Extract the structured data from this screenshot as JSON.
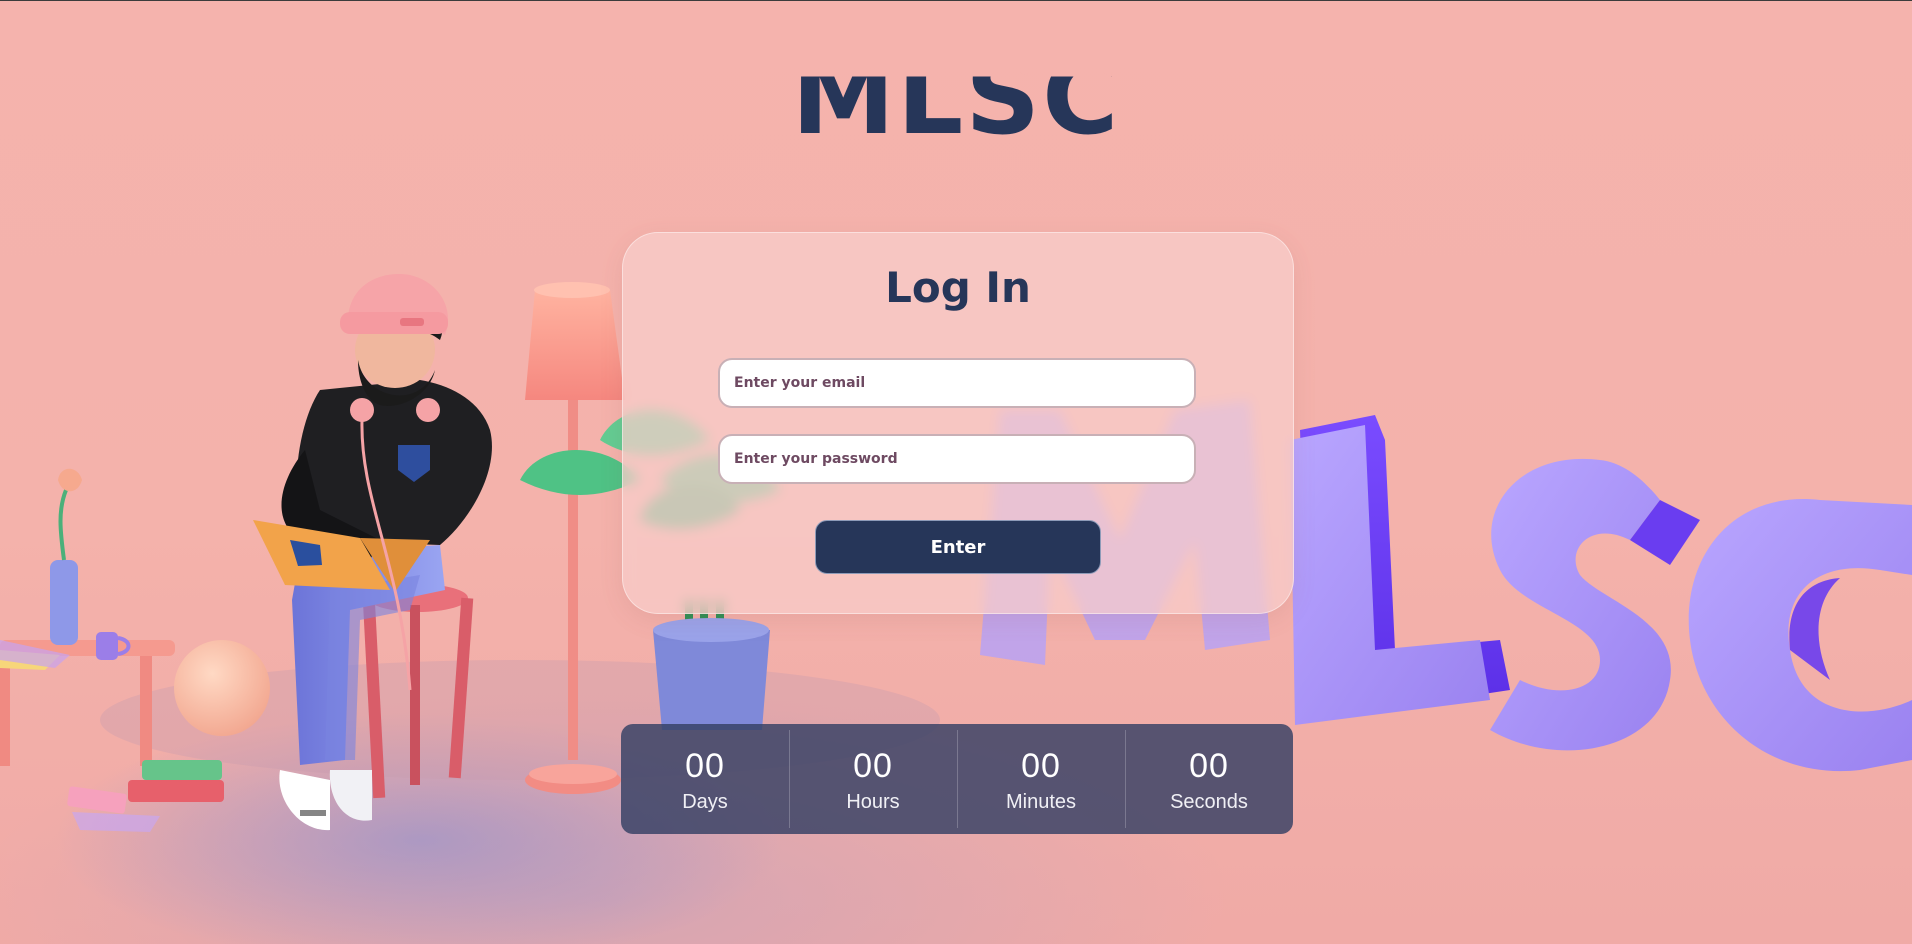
{
  "brand": {
    "logo_text": "MLSC"
  },
  "login": {
    "title": "Log In",
    "email_placeholder": "Enter your email",
    "password_placeholder": "Enter your password",
    "enter_label": "Enter"
  },
  "countdown": [
    {
      "value": "00",
      "label": "Days"
    },
    {
      "value": "00",
      "label": "Hours"
    },
    {
      "value": "00",
      "label": "Minutes"
    },
    {
      "value": "00",
      "label": "Seconds"
    }
  ],
  "illustration": {
    "letters_text": "MLSC",
    "colors": {
      "background": "#f5b3ad",
      "navy": "#263659",
      "purple_letters": "#9f87ef",
      "hoodie": "#1d1d1d",
      "beanie": "#f5a3a6",
      "laptop": "#f2a34a",
      "plant": "#55c48a",
      "lamp": "#f59c92",
      "vase": "#8a95e3"
    }
  }
}
